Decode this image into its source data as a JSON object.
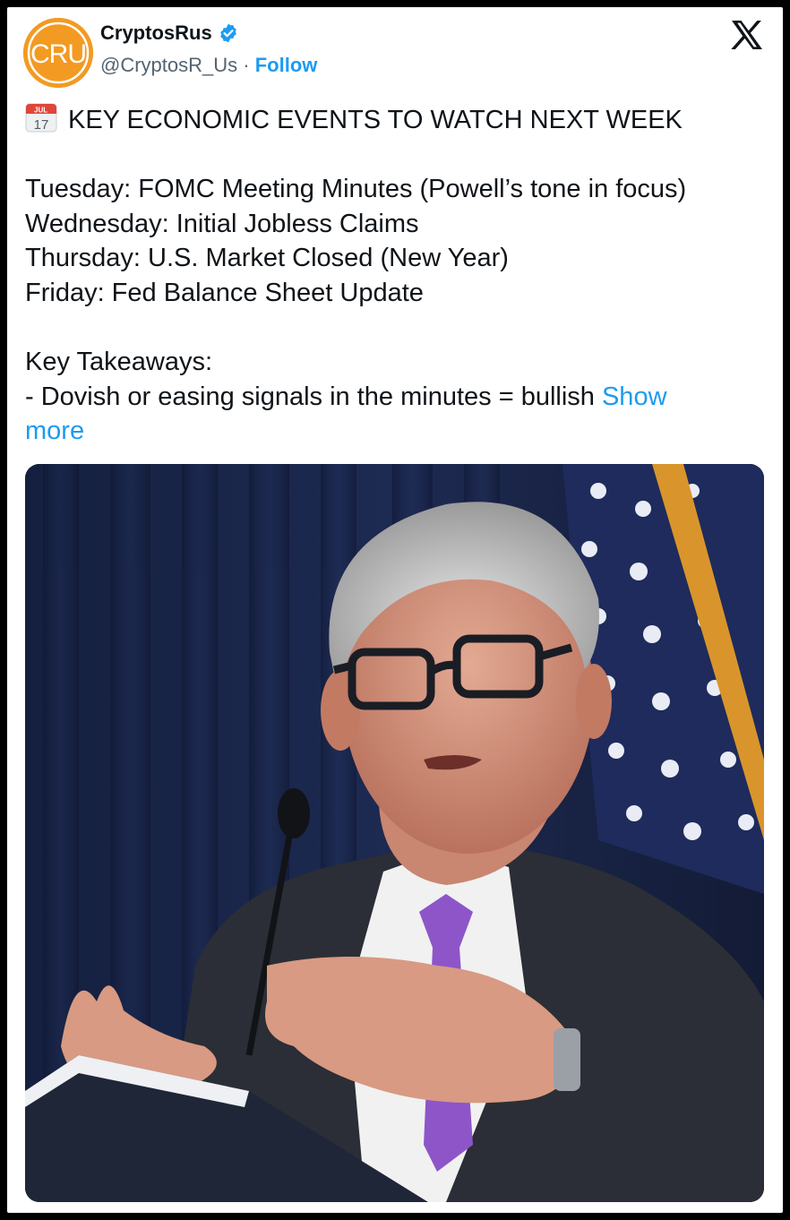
{
  "author": {
    "name": "CryptosRus",
    "handle": "@CryptosR_Us",
    "separator": "·",
    "follow_label": "Follow",
    "avatar_text": "CRU",
    "avatar_color": "#f39a22",
    "verified_color": "#1d9bf0"
  },
  "platform_icon": "x-logo-icon",
  "tweet": {
    "heading_icon": "calendar-icon",
    "heading_icon_month": "JUL",
    "heading_icon_day": "17",
    "heading": "KEY ECONOMIC EVENTS TO WATCH NEXT WEEK",
    "events": [
      "Tuesday: FOMC Meeting Minutes (Powell’s tone in focus)",
      "Wednesday: Initial Jobless Claims",
      "Thursday: U.S. Market Closed (New Year)",
      "Friday: Fed Balance Sheet Update"
    ],
    "takeaways_title": "Key Takeaways:",
    "takeaway_1": "- Dovish or easing signals in the minutes = bullish",
    "show_more_first": "Show",
    "show_more_second": "more"
  },
  "colors": {
    "link": "#1d9bf0",
    "text": "#0f1419",
    "muted": "#536471"
  }
}
